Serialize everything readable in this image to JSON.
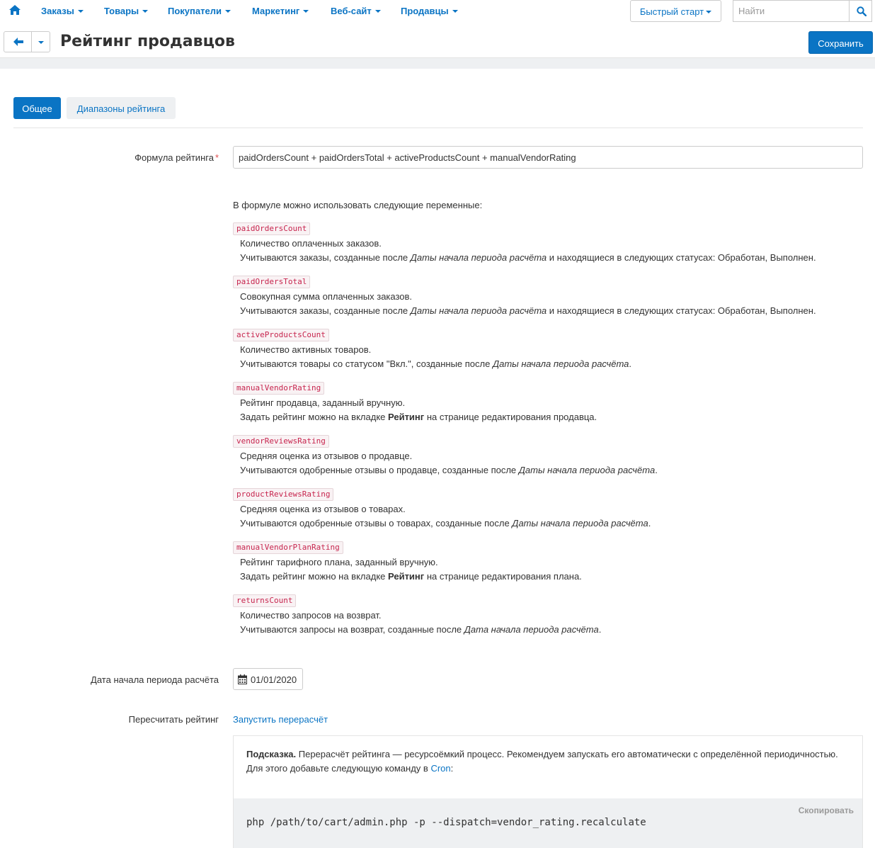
{
  "nav": {
    "items": [
      "Заказы",
      "Товары",
      "Покупатели",
      "Маркетинг",
      "Веб-сайт",
      "Продавцы"
    ],
    "quick_start": "Быстрый старт",
    "search_placeholder": "Найти"
  },
  "header": {
    "title": "Рейтинг продавцов",
    "save_label": "Сохранить"
  },
  "tabs": {
    "general": "Общее",
    "ranges": "Диапазоны рейтинга"
  },
  "form": {
    "formula_label": "Формула рейтинга",
    "formula_value": "paidOrdersCount + paidOrdersTotal + activeProductsCount + manualVendorRating",
    "intro": "В формуле можно использовать следующие переменные:",
    "date_label": "Дата начала периода расчёта",
    "date_value": "01/01/2020",
    "recalc_label": "Пересчитать рейтинг",
    "recalc_link": "Запустить перерасчёт"
  },
  "variables": [
    {
      "code": "paidOrdersCount",
      "line1": "Количество оплаченных заказов.",
      "line2a": "Учитываются заказы, созданные после ",
      "line2em": "Даты начала периода расчёта",
      "line2b": " и находящиеся в следующих статусах: Обработан, Выполнен.",
      "line2strong": ""
    },
    {
      "code": "paidOrdersTotal",
      "line1": "Совокупная сумма оплаченных заказов.",
      "line2a": "Учитываются заказы, созданные после ",
      "line2em": "Даты начала периода расчёта",
      "line2b": " и находящиеся в следующих статусах: Обработан, Выполнен.",
      "line2strong": ""
    },
    {
      "code": "activeProductsCount",
      "line1": "Количество активных товаров.",
      "line2a": "Учитываются товары со статусом \"Вкл.\", созданные после ",
      "line2em": "Даты начала периода расчёта",
      "line2b": ".",
      "line2strong": ""
    },
    {
      "code": "manualVendorRating",
      "line1": "Рейтинг продавца, заданный вручную.",
      "line2a": "Задать рейтинг можно на вкладке ",
      "line2strong": "Рейтинг",
      "line2b": " на странице редактирования продавца.",
      "line2em": ""
    },
    {
      "code": "vendorReviewsRating",
      "line1": "Средняя оценка из отзывов о продавце.",
      "line2a": "Учитываются одобренные отзывы о продавце, созданные после ",
      "line2em": "Даты начала периода расчёта",
      "line2b": ".",
      "line2strong": ""
    },
    {
      "code": "productReviewsRating",
      "line1": "Средняя оценка из отзывов о товарах.",
      "line2a": "Учитываются одобренные отзывы о товарах, созданные после ",
      "line2em": "Даты начала периода расчёта",
      "line2b": ".",
      "line2strong": ""
    },
    {
      "code": "manualVendorPlanRating",
      "line1": "Рейтинг тарифного плана, заданный вручную.",
      "line2a": "Задать рейтинг можно на вкладке ",
      "line2strong": "Рейтинг",
      "line2b": " на странице редактирования плана.",
      "line2em": ""
    },
    {
      "code": "returnsCount",
      "line1": "Количество запросов на возврат.",
      "line2a": "Учитываются запросы на возврат, созданные после ",
      "line2em": "Дата начала периода расчёта",
      "line2b": ".",
      "line2strong": ""
    }
  ],
  "hint": {
    "title": "Подсказка.",
    "text": " Перерасчёт рейтинга — ресурсоёмкий процесс. Рекомендуем запускать его автоматически с определённой периодичностью.",
    "line2": "Для этого добавьте следующую команду в ",
    "link": "Cron",
    "line2_end": ":",
    "copy_label": "Скопировать",
    "command": "php /path/to/cart/admin.php -p --dispatch=vendor_rating.recalculate"
  },
  "colors": {
    "accent": "#0a74c4",
    "code_text": "#c7254e",
    "required": "#e04f50"
  }
}
